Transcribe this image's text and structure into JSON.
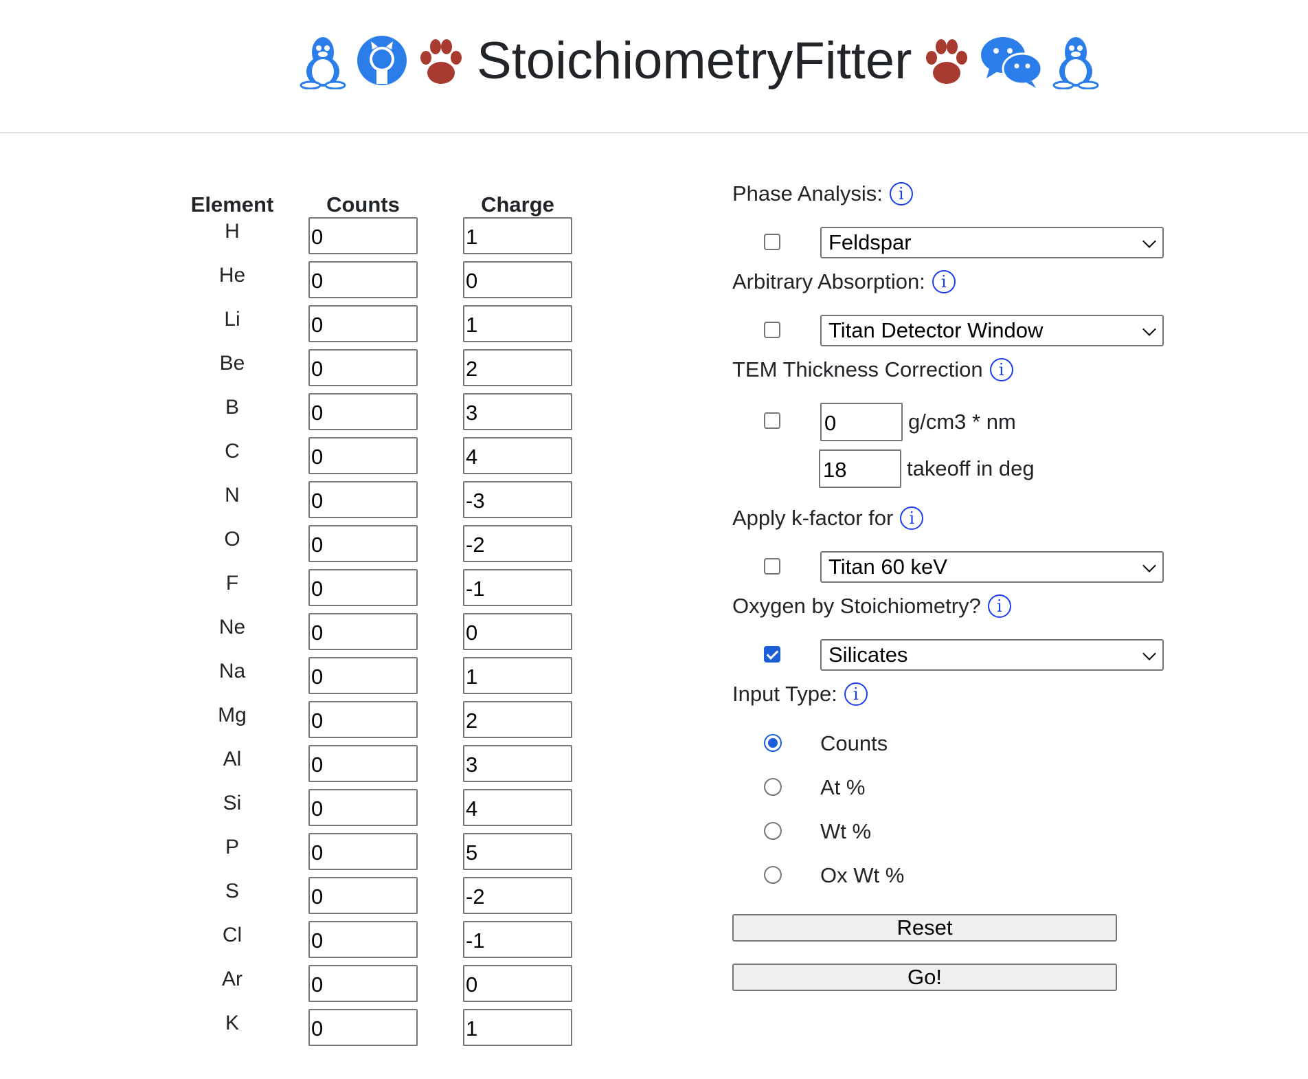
{
  "header": {
    "title": "StoichiometryFitter",
    "icons": [
      "linux-penguin-icon",
      "github-icon",
      "paw-icon",
      "paw-icon",
      "wechat-icon",
      "linux-penguin-icon"
    ],
    "colors": {
      "blue": "#2b7de9",
      "paw": "#a83a2f"
    }
  },
  "table": {
    "headers": [
      "Element",
      "Counts",
      "Charge"
    ],
    "rows": [
      {
        "element": "H",
        "counts": "0",
        "charge": "1"
      },
      {
        "element": "He",
        "counts": "0",
        "charge": "0"
      },
      {
        "element": "Li",
        "counts": "0",
        "charge": "1"
      },
      {
        "element": "Be",
        "counts": "0",
        "charge": "2"
      },
      {
        "element": "B",
        "counts": "0",
        "charge": "3"
      },
      {
        "element": "C",
        "counts": "0",
        "charge": "4"
      },
      {
        "element": "N",
        "counts": "0",
        "charge": "-3"
      },
      {
        "element": "O",
        "counts": "0",
        "charge": "-2"
      },
      {
        "element": "F",
        "counts": "0",
        "charge": "-1"
      },
      {
        "element": "Ne",
        "counts": "0",
        "charge": "0"
      },
      {
        "element": "Na",
        "counts": "0",
        "charge": "1"
      },
      {
        "element": "Mg",
        "counts": "0",
        "charge": "2"
      },
      {
        "element": "Al",
        "counts": "0",
        "charge": "3"
      },
      {
        "element": "Si",
        "counts": "0",
        "charge": "4"
      },
      {
        "element": "P",
        "counts": "0",
        "charge": "5"
      },
      {
        "element": "S",
        "counts": "0",
        "charge": "-2"
      },
      {
        "element": "Cl",
        "counts": "0",
        "charge": "-1"
      },
      {
        "element": "Ar",
        "counts": "0",
        "charge": "0"
      },
      {
        "element": "K",
        "counts": "0",
        "charge": "1"
      }
    ]
  },
  "panel": {
    "info_glyph": "i",
    "phase_analysis": {
      "label": "Phase Analysis:",
      "checked": false,
      "selected": "Feldspar"
    },
    "absorption": {
      "label": "Arbitrary Absorption:",
      "checked": false,
      "selected": "Titan Detector Window"
    },
    "thickness": {
      "label": "TEM Thickness Correction",
      "checked": false,
      "value": "0",
      "unit": "g/cm3 * nm",
      "takeoff_value": "18",
      "takeoff_label": "takeoff in deg"
    },
    "kfactor": {
      "label": "Apply k-factor for",
      "checked": false,
      "selected": "Titan 60 keV"
    },
    "oxygen": {
      "label": "Oxygen by Stoichiometry?",
      "checked": true,
      "selected": "Silicates"
    },
    "input_type": {
      "label": "Input Type:",
      "options": [
        "Counts",
        "At %",
        "Wt %",
        "Ox Wt %"
      ],
      "selected": "Counts"
    },
    "reset_label": "Reset",
    "go_label": "Go!"
  }
}
